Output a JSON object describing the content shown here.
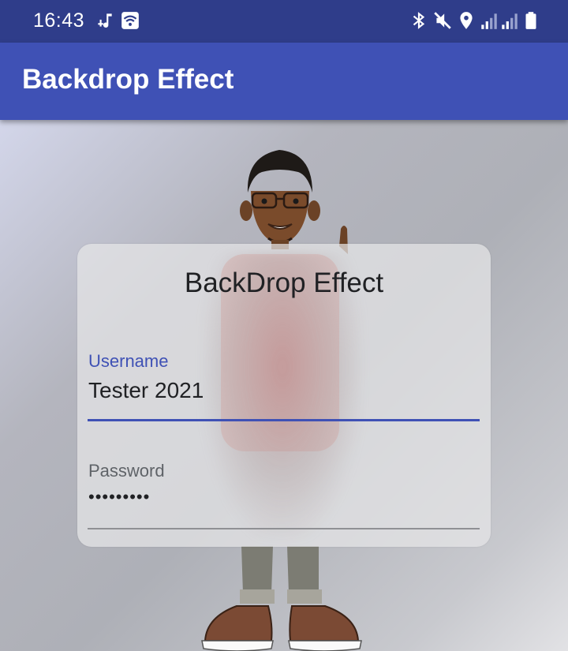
{
  "status_bar": {
    "time": "16:43",
    "left_icons": [
      "music-icon",
      "wifi-box-icon"
    ],
    "right_icons": [
      "bluetooth-icon",
      "mute-icon",
      "location-icon",
      "signal-icon",
      "signal-icon",
      "battery-icon"
    ]
  },
  "app_bar": {
    "title": "Backdrop Effect"
  },
  "card": {
    "title": "BackDrop Effect",
    "username": {
      "label": "Username",
      "value": "Tester 2021"
    },
    "password": {
      "label": "Password",
      "value": "•••••••••"
    }
  },
  "colors": {
    "status_bar": "#2f3d8a",
    "app_bar": "#3f51b5",
    "accent": "#3f51b5"
  }
}
